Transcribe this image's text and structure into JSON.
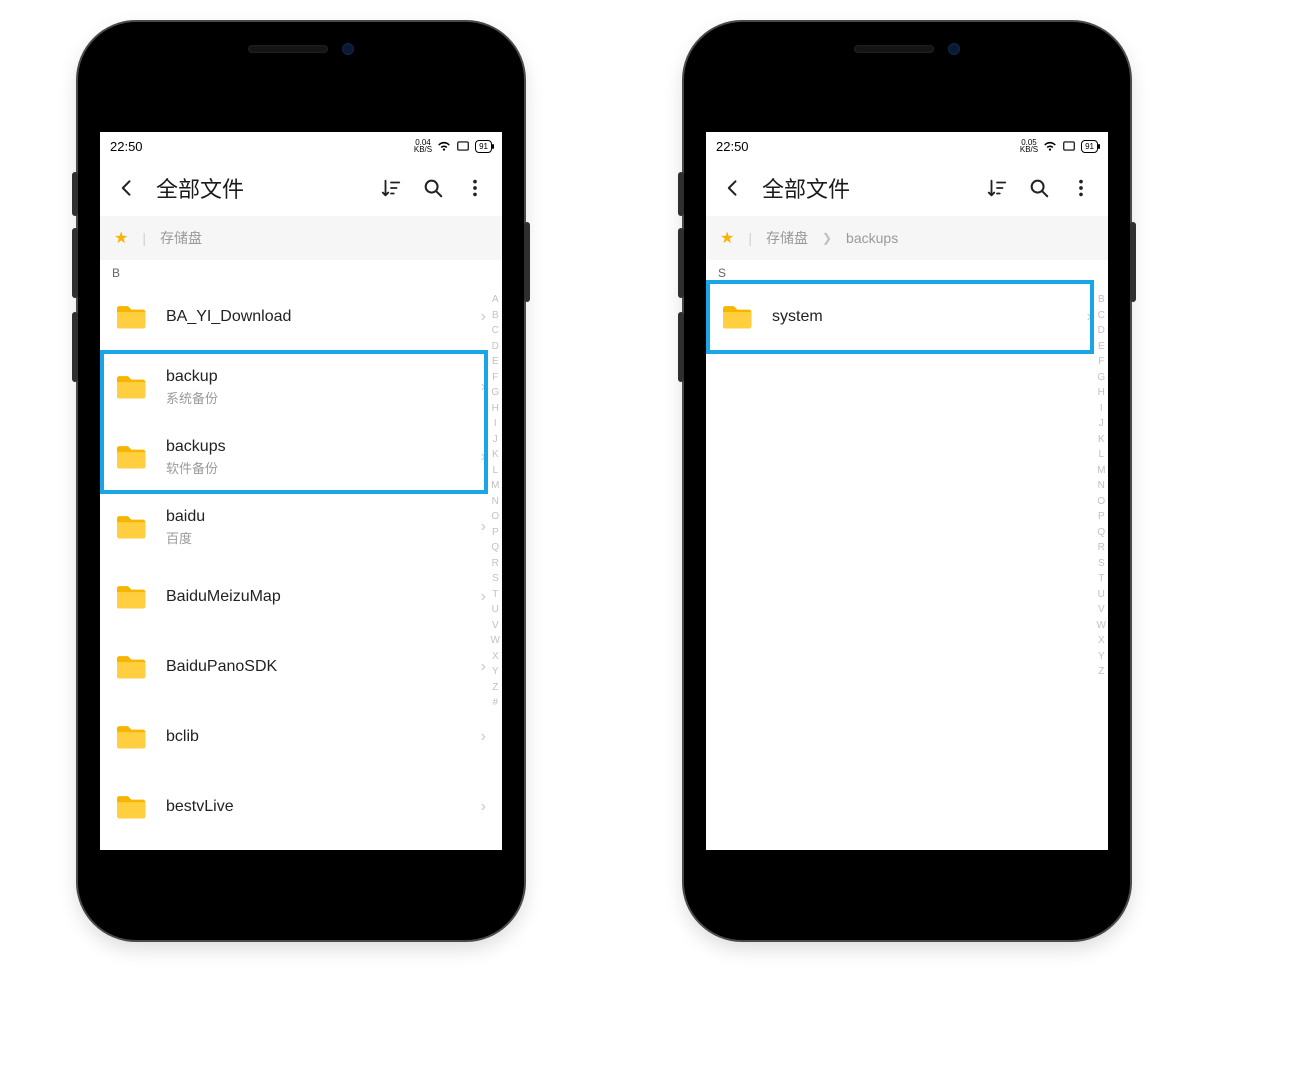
{
  "phone1": {
    "status": {
      "time": "22:50",
      "speed_value": "0.04",
      "speed_unit": "KB/S",
      "battery": "91"
    },
    "appbar": {
      "title": "全部文件"
    },
    "breadcrumb": {
      "items": [
        {
          "label": "存储盘"
        }
      ]
    },
    "section_letter": "B",
    "folders": [
      {
        "name": "BA_YI_Download",
        "sub": ""
      },
      {
        "name": "backup",
        "sub": "系统备份"
      },
      {
        "name": "backups",
        "sub": "软件备份"
      },
      {
        "name": "baidu",
        "sub": "百度"
      },
      {
        "name": "BaiduMeizuMap",
        "sub": ""
      },
      {
        "name": "BaiduPanoSDK",
        "sub": ""
      },
      {
        "name": "bclib",
        "sub": ""
      },
      {
        "name": "bestvLive",
        "sub": ""
      }
    ],
    "highlight": {
      "start_index": 1,
      "end_index": 2
    },
    "alpha": [
      "A",
      "B",
      "C",
      "D",
      "E",
      "F",
      "G",
      "H",
      "I",
      "J",
      "K",
      "L",
      "M",
      "N",
      "O",
      "P",
      "Q",
      "R",
      "S",
      "T",
      "U",
      "V",
      "W",
      "X",
      "Y",
      "Z",
      "#"
    ]
  },
  "phone2": {
    "status": {
      "time": "22:50",
      "speed_value": "0.05",
      "speed_unit": "KB/S",
      "battery": "91"
    },
    "appbar": {
      "title": "全部文件"
    },
    "breadcrumb": {
      "items": [
        {
          "label": "存储盘"
        },
        {
          "label": "backups"
        }
      ]
    },
    "section_letter": "S",
    "folders": [
      {
        "name": "system",
        "sub": ""
      }
    ],
    "highlight": {
      "start_index": 0,
      "end_index": 0
    },
    "alpha": [
      "B",
      "C",
      "D",
      "E",
      "F",
      "G",
      "H",
      "I",
      "J",
      "K",
      "L",
      "M",
      "N",
      "O",
      "P",
      "Q",
      "R",
      "S",
      "T",
      "U",
      "V",
      "W",
      "X",
      "Y",
      "Z"
    ]
  }
}
